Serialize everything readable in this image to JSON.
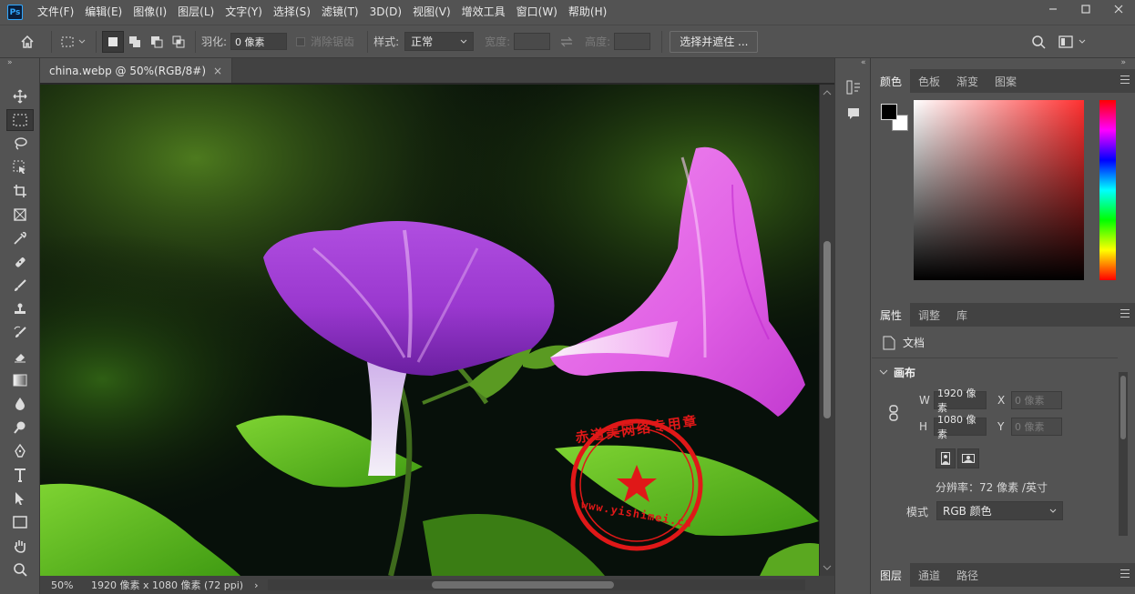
{
  "app": {
    "logo": "Ps"
  },
  "menu": [
    "文件(F)",
    "编辑(E)",
    "图像(I)",
    "图层(L)",
    "文字(Y)",
    "选择(S)",
    "滤镜(T)",
    "3D(D)",
    "视图(V)",
    "增效工具",
    "窗口(W)",
    "帮助(H)"
  ],
  "options": {
    "feather_label": "羽化:",
    "feather_value": "0 像素",
    "antialias_label": "消除锯齿",
    "style_label": "样式:",
    "style_value": "正常",
    "width_label": "宽度:",
    "height_label": "高度:",
    "select_mask_button": "选择并遮住 ..."
  },
  "document": {
    "tab_title": "china.webp @ 50%(RGB/8#)",
    "tab_close": "×",
    "zoom": "50%",
    "size_info": "1920 像素 x 1080 像素 (72 ppi)",
    "status_arrow": "›"
  },
  "color_panel": {
    "tabs": [
      "颜色",
      "色板",
      "渐变",
      "图案"
    ],
    "foreground": "#000000",
    "background": "#ffffff"
  },
  "properties_panel": {
    "tabs": [
      "属性",
      "调整",
      "库"
    ],
    "doc_label": "文档",
    "canvas_section": "画布",
    "w_label": "W",
    "w_value": "1920 像素",
    "h_label": "H",
    "h_value": "1080 像素",
    "x_label": "X",
    "x_placeholder": "0 像素",
    "y_label": "Y",
    "y_placeholder": "0 像素",
    "resolution": "分辨率：72 像素 /英寸",
    "mode_label": "模式",
    "mode_value": "RGB 颜色"
  },
  "layers_panel": {
    "tabs": [
      "图层",
      "通道",
      "路径"
    ]
  },
  "watermark": {
    "text_top": "赤道美网络专用章",
    "text_bottom": "www.yishimei.cn",
    "color": "#e01818"
  },
  "icons": {
    "tools": [
      "move-icon",
      "marquee-icon",
      "lasso-icon",
      "object-select-icon",
      "crop-icon",
      "frame-icon",
      "eyedropper-icon",
      "healing-icon",
      "brush-icon",
      "stamp-icon",
      "history-brush-icon",
      "eraser-icon",
      "gradient-icon",
      "blur-icon",
      "dodge-icon",
      "pen-icon",
      "type-icon",
      "path-select-icon",
      "rectangle-icon",
      "hand-icon",
      "zoom-icon"
    ]
  }
}
